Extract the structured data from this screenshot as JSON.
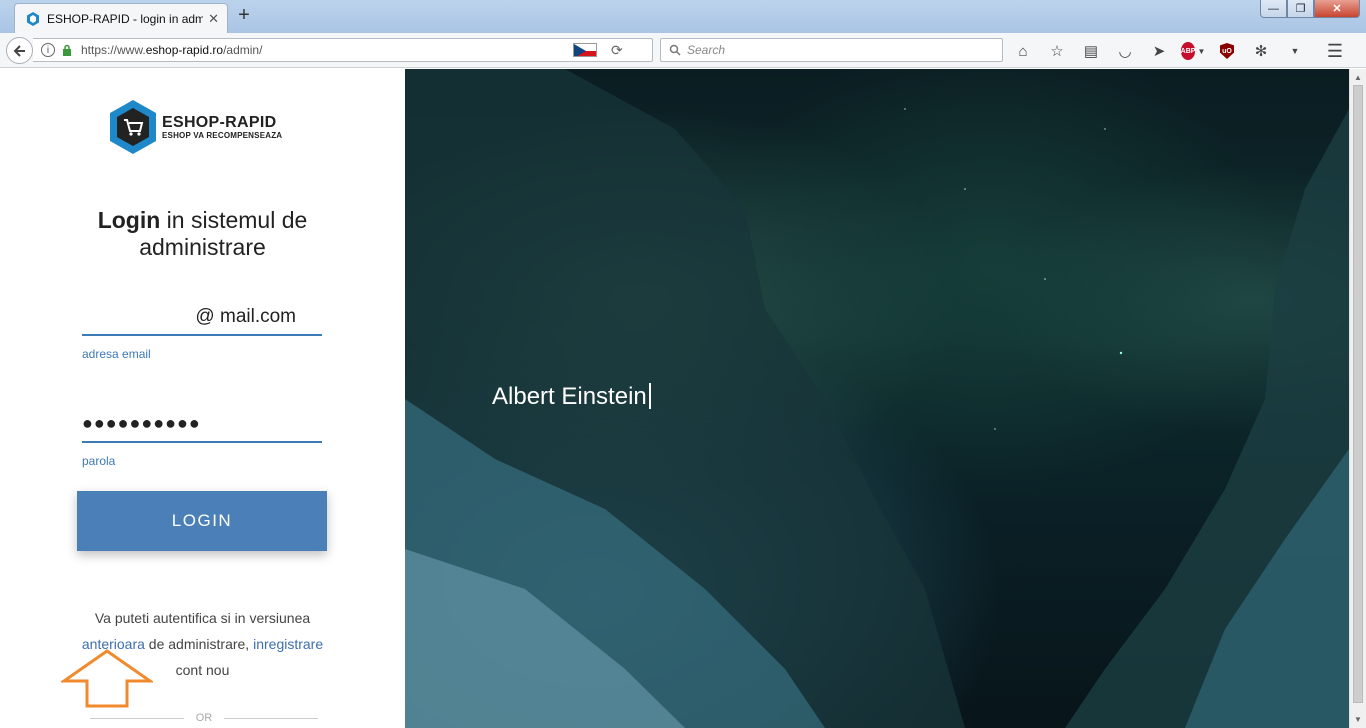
{
  "browser": {
    "tab_title": "ESHOP-RAPID - login in adm",
    "tab_close": "✕",
    "new_tab": "+",
    "url_prefix": "https://www.",
    "url_domain": "eshop-rapid.ro",
    "url_path": "/admin/",
    "search_placeholder": "Search",
    "win_min": "—",
    "win_max": "❐",
    "win_close": "✕"
  },
  "logo": {
    "name": "ESHOP-RAPID",
    "tagline": "ESHOP VA RECOMPENSEAZA"
  },
  "heading": {
    "bold": "Login",
    "rest": " in sistemul de administrare"
  },
  "form": {
    "email_value": "@  mail.com",
    "email_label": "adresa email",
    "password_value": "●●●●●●●●●●",
    "password_label": "parola",
    "login_label": "LOGIN"
  },
  "info": {
    "line1": "Va puteti autentifica si in versiunea",
    "link_previous": "anterioara",
    "middle": " de administrare, ",
    "link_register": "inregistrare",
    "end": "cont nou"
  },
  "or_text": "OR",
  "hero": {
    "quote": "Albert Einstein"
  },
  "colors": {
    "accent": "#4a7fb8",
    "link": "#3d6fb0",
    "arrow": "#f08a2c"
  }
}
